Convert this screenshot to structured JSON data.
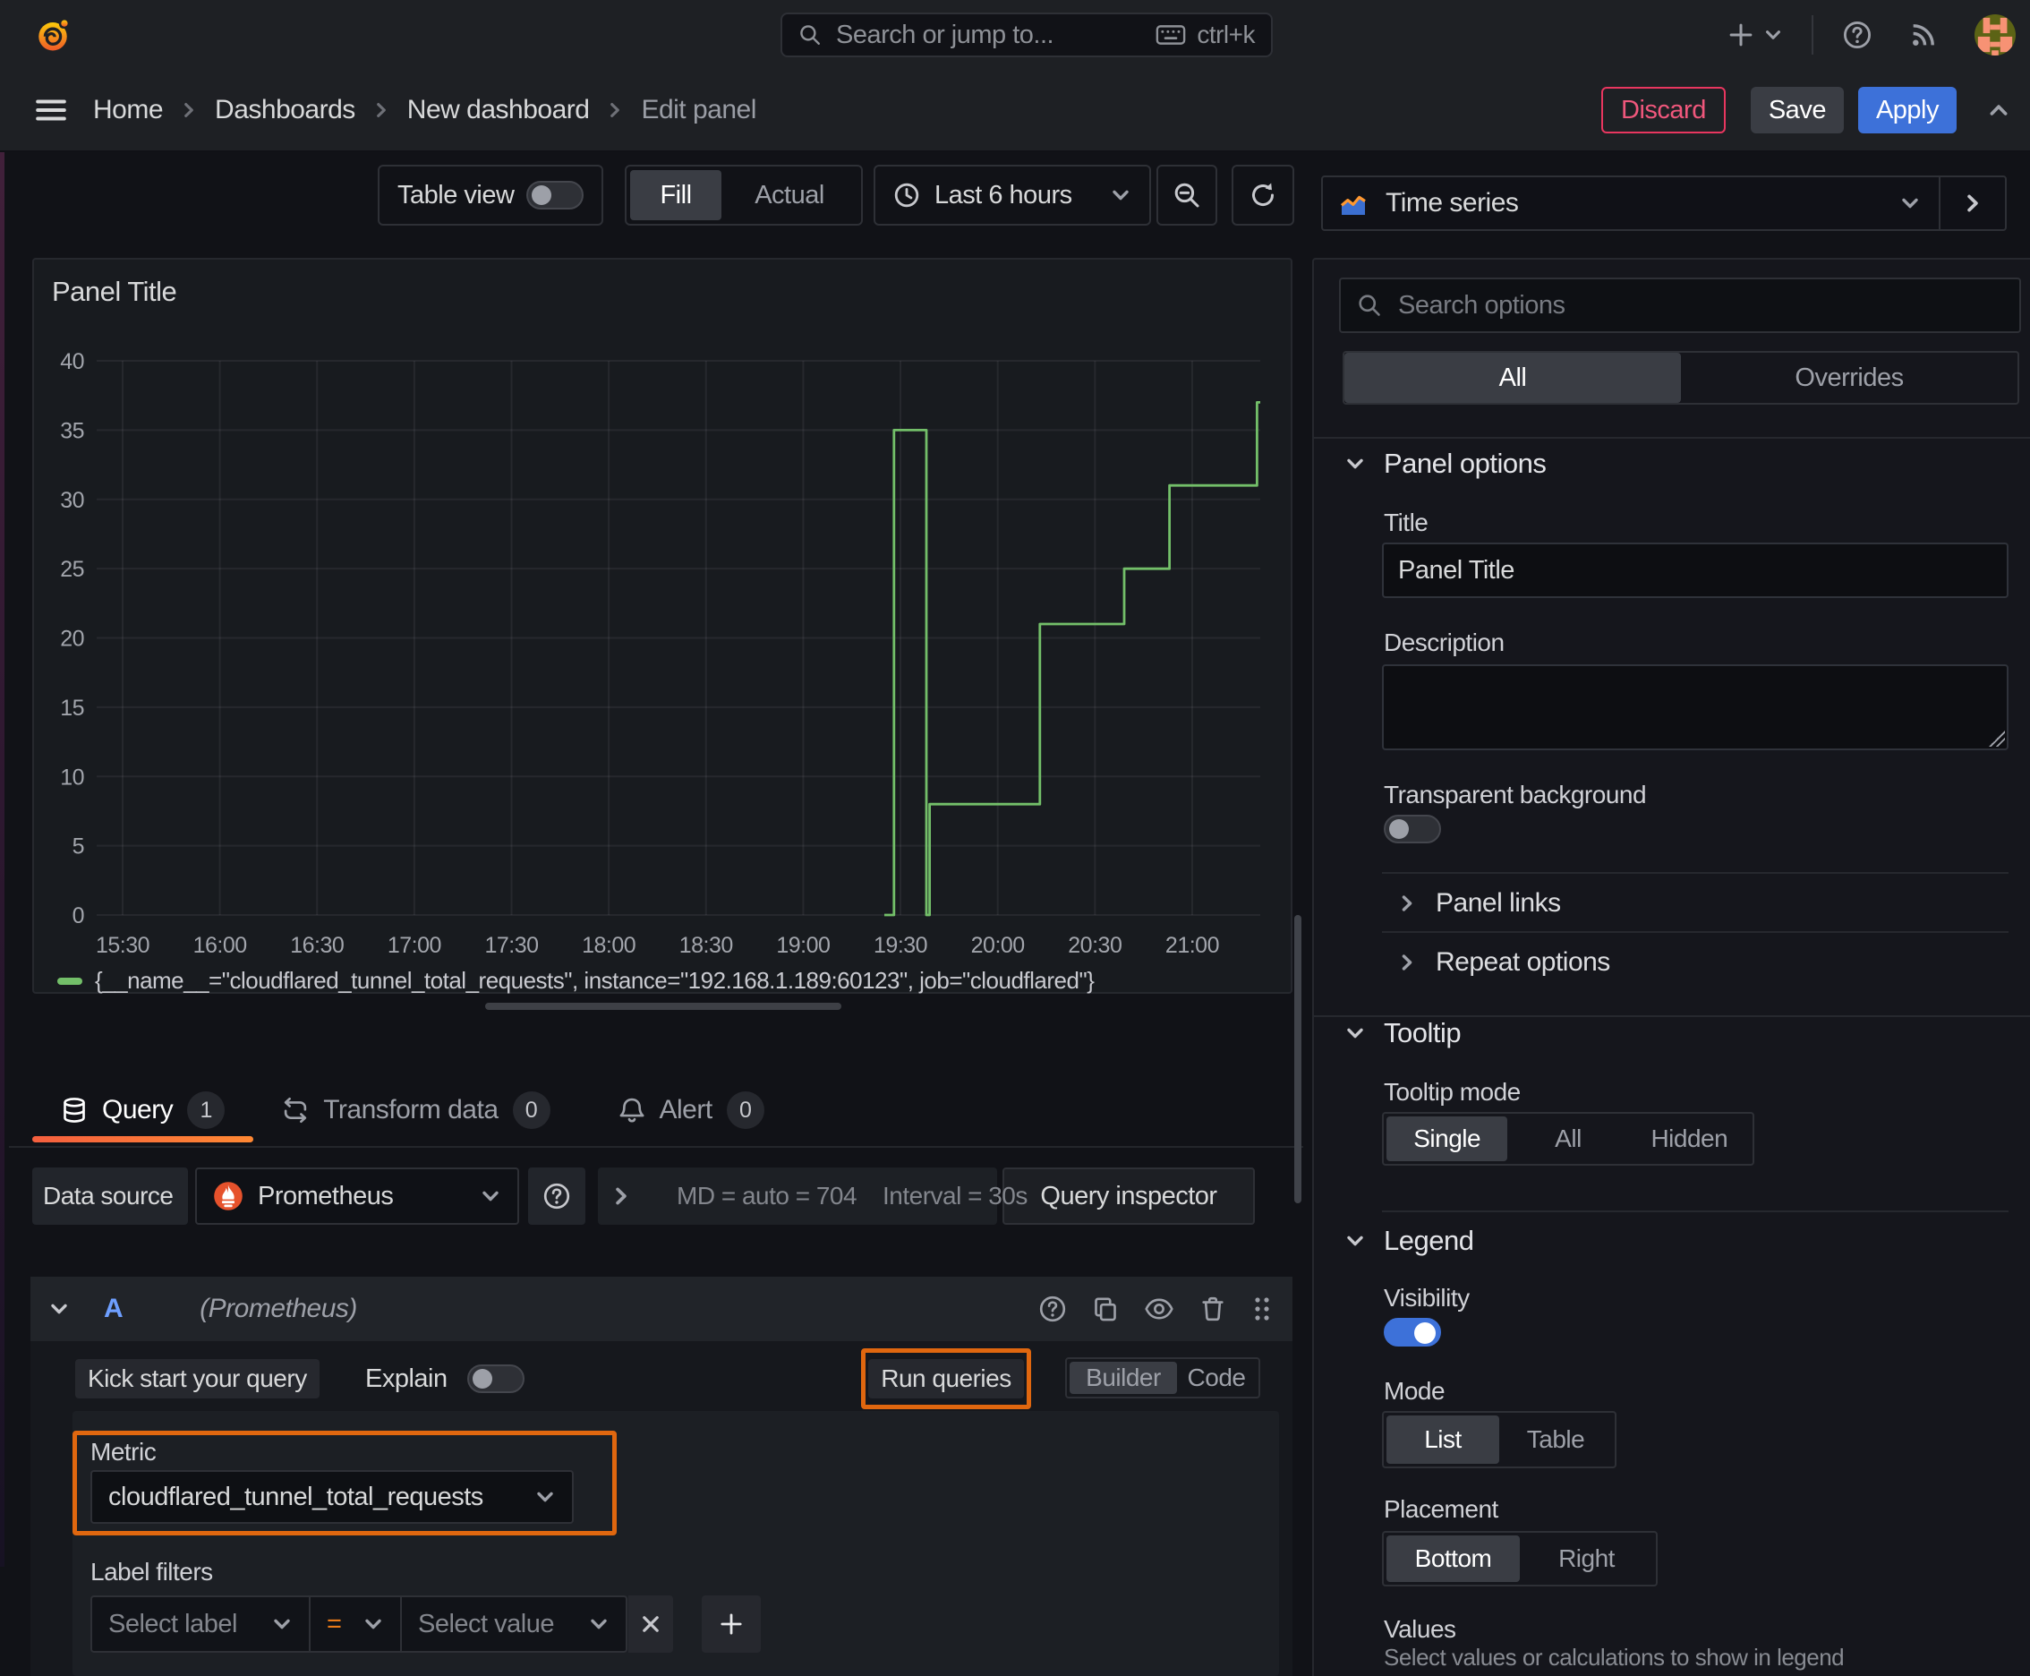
{
  "topbar": {
    "search_placeholder": "Search or jump to...",
    "search_shortcut": "ctrl+k"
  },
  "breadcrumb": {
    "items": [
      "Home",
      "Dashboards",
      "New dashboard",
      "Edit panel"
    ]
  },
  "header_actions": {
    "discard": "Discard",
    "save": "Save",
    "apply": "Apply"
  },
  "toolbar": {
    "table_view": "Table view",
    "fill": "Fill",
    "actual": "Actual",
    "time_range": "Last 6 hours"
  },
  "panel": {
    "title": "Panel Title",
    "legend": "{__name__=\"cloudflared_tunnel_total_requests\", instance=\"192.168.1.189:60123\", job=\"cloudflared\"}"
  },
  "chart_data": {
    "type": "line",
    "title": "Panel Title",
    "line_interpolation": "step-after",
    "grid": true,
    "legend_position": "bottom",
    "series": [
      {
        "name": "{__name__=\"cloudflared_tunnel_total_requests\", instance=\"192.168.1.189:60123\", job=\"cloudflared\"}",
        "color": "#73bf69",
        "points": [
          [
            "19:25",
            0
          ],
          [
            "19:28",
            35
          ],
          [
            "19:38",
            0
          ],
          [
            "19:39",
            8
          ],
          [
            "20:13",
            21
          ],
          [
            "20:39",
            25
          ],
          [
            "20:53",
            31
          ],
          [
            "21:20",
            37
          ]
        ]
      }
    ],
    "x_range": [
      "15:22",
      "21:21"
    ],
    "x_ticks": [
      "15:30",
      "16:00",
      "16:30",
      "17:00",
      "17:30",
      "18:00",
      "18:30",
      "19:00",
      "19:30",
      "20:00",
      "20:30",
      "21:00"
    ],
    "xlabel": "",
    "ylabel": "",
    "ylim": [
      0,
      40
    ],
    "y_ticks": [
      0,
      5,
      10,
      15,
      20,
      25,
      30,
      35,
      40
    ]
  },
  "tabs": {
    "query": "Query",
    "query_count": "1",
    "transform": "Transform data",
    "transform_count": "0",
    "alert": "Alert",
    "alert_count": "0"
  },
  "datasource_row": {
    "label": "Data source",
    "value": "Prometheus",
    "md_text": "MD = auto = 704",
    "interval_text": "Interval = 30s",
    "inspector": "Query inspector"
  },
  "query_editor": {
    "ref_id": "A",
    "ds_hint": "(Prometheus)",
    "kick_start": "Kick start your query",
    "explain": "Explain",
    "run_queries": "Run queries",
    "builder": "Builder",
    "code": "Code",
    "metric_label": "Metric",
    "metric_value": "cloudflared_tunnel_total_requests",
    "label_filters": "Label filters",
    "select_label": "Select label",
    "equals": "=",
    "select_value": "Select value"
  },
  "sidebar": {
    "visualization": "Time series",
    "search_placeholder": "Search options",
    "tab_all": "All",
    "tab_overrides": "Overrides",
    "panel_options": {
      "header": "Panel options",
      "title_label": "Title",
      "title_value": "Panel Title",
      "description_label": "Description",
      "transparent_label": "Transparent background"
    },
    "links": {
      "panel_links": "Panel links",
      "repeat_options": "Repeat options"
    },
    "tooltip": {
      "header": "Tooltip",
      "mode_label": "Tooltip mode",
      "options": [
        "Single",
        "All",
        "Hidden"
      ],
      "selected": "Single"
    },
    "legend": {
      "header": "Legend",
      "visibility_label": "Visibility",
      "mode_label": "Mode",
      "mode_options": [
        "List",
        "Table"
      ],
      "mode_selected": "List",
      "placement_label": "Placement",
      "placement_options": [
        "Bottom",
        "Right"
      ],
      "placement_selected": "Bottom",
      "values_label": "Values",
      "values_caption": "Select values or calculations to show in legend"
    }
  },
  "colors": {
    "annotation_orange": "#e0670f",
    "series_green": "#73bf69",
    "apply_blue": "#3d71d9",
    "discard_pink": "#e8365f",
    "tab_underline": [
      "#f55f3e",
      "#ff8833"
    ]
  }
}
